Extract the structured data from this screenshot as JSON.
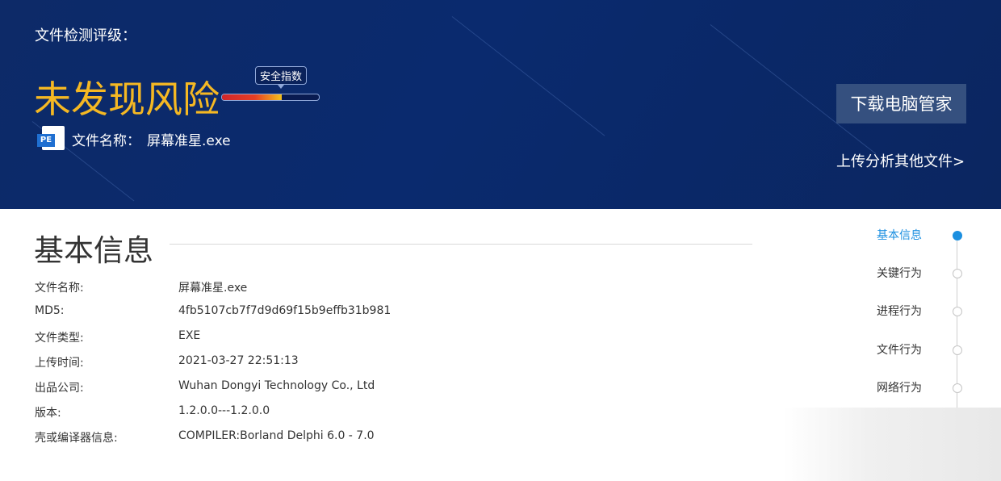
{
  "hero": {
    "grade_label": "文件检测评级：",
    "verdict": "未发现风险",
    "safety_index": {
      "label": "安全指数",
      "level": 0.62
    },
    "file_name_label": "文件名称：",
    "file_name": "屏幕准星.exe",
    "file_icon_text": "PE",
    "download_button": "下载电脑管家",
    "upload_link": "上传分析其他文件>"
  },
  "section": {
    "title": "基本信息",
    "rows": [
      {
        "key": "文件名称:",
        "value": "屏幕准星.exe"
      },
      {
        "key": "MD5:",
        "value": "4fb5107cb7f7d9d69f15b9effb31b981"
      },
      {
        "key": "文件类型:",
        "value": "EXE"
      },
      {
        "key": "上传时间:",
        "value": "2021-03-27 22:51:13"
      },
      {
        "key": "出品公司:",
        "value": "Wuhan Dongyi Technology Co., Ltd"
      },
      {
        "key": "版本:",
        "value": "1.2.0.0---1.2.0.0"
      },
      {
        "key": "壳或编译器信息:",
        "value": "COMPILER:Borland Delphi 6.0 - 7.0"
      }
    ]
  },
  "nav": {
    "items": [
      {
        "label": "基本信息",
        "active": true
      },
      {
        "label": "关键行为",
        "active": false
      },
      {
        "label": "进程行为",
        "active": false
      },
      {
        "label": "文件行为",
        "active": false
      },
      {
        "label": "网络行为",
        "active": false
      }
    ]
  },
  "colors": {
    "hero_bg": "#0a2a6e",
    "verdict": "#f5b823",
    "accent": "#1b8fe0",
    "button_bg": "#35507f"
  }
}
